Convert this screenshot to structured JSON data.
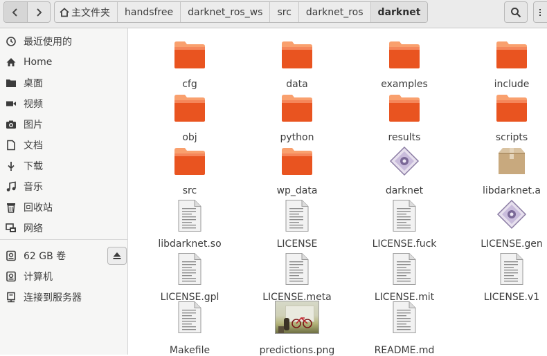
{
  "navigation": {
    "back_icon": "chevron-left-icon",
    "forward_icon": "chevron-right-icon"
  },
  "breadcrumbs": [
    {
      "label": "主文件夹",
      "icon": "home-icon"
    },
    {
      "label": "handsfree"
    },
    {
      "label": "darknet_ros_ws"
    },
    {
      "label": "src"
    },
    {
      "label": "darknet_ros"
    },
    {
      "label": "darknet"
    }
  ],
  "toolbar": {
    "search_icon": "search-icon",
    "menu_icon": "hamburger-menu-icon"
  },
  "sidebar": {
    "places": [
      {
        "label": "最近使用的",
        "icon": "recent-clock-icon"
      },
      {
        "label": "Home",
        "icon": "home-icon"
      },
      {
        "label": "桌面",
        "icon": "desktop-folder-icon"
      },
      {
        "label": "视频",
        "icon": "video-icon"
      },
      {
        "label": "图片",
        "icon": "camera-icon"
      },
      {
        "label": "文档",
        "icon": "document-icon"
      },
      {
        "label": "下载",
        "icon": "download-icon"
      },
      {
        "label": "音乐",
        "icon": "music-icon"
      },
      {
        "label": "回收站",
        "icon": "trash-icon"
      },
      {
        "label": "网络",
        "icon": "network-icon"
      }
    ],
    "devices": [
      {
        "label": "62 GB 卷",
        "icon": "drive-icon"
      },
      {
        "label": "计算机",
        "icon": "computer-drive-icon"
      },
      {
        "label": "连接到服务器",
        "icon": "server-icon"
      }
    ],
    "eject_icon": "eject-icon"
  },
  "files": [
    {
      "name": "cfg",
      "type": "folder"
    },
    {
      "name": "data",
      "type": "folder"
    },
    {
      "name": "examples",
      "type": "folder"
    },
    {
      "name": "include",
      "type": "folder"
    },
    {
      "name": "obj",
      "type": "folder"
    },
    {
      "name": "python",
      "type": "folder"
    },
    {
      "name": "results",
      "type": "folder"
    },
    {
      "name": "scripts",
      "type": "folder"
    },
    {
      "name": "src",
      "type": "folder"
    },
    {
      "name": "wp_data",
      "type": "folder"
    },
    {
      "name": "darknet",
      "type": "executable"
    },
    {
      "name": "libdarknet.a",
      "type": "archive"
    },
    {
      "name": "libdarknet.so",
      "type": "text"
    },
    {
      "name": "LICENSE",
      "type": "text"
    },
    {
      "name": "LICENSE.fuck",
      "type": "text"
    },
    {
      "name": "LICENSE.gen",
      "type": "executable"
    },
    {
      "name": "LICENSE.gpl",
      "type": "text"
    },
    {
      "name": "LICENSE.meta",
      "type": "text"
    },
    {
      "name": "LICENSE.mit",
      "type": "text"
    },
    {
      "name": "LICENSE.v1",
      "type": "text"
    },
    {
      "name": "Makefile",
      "type": "text"
    },
    {
      "name": "predictions.png",
      "type": "image"
    },
    {
      "name": "README.md",
      "type": "text"
    }
  ],
  "colors": {
    "folder_top": "#f9a06e",
    "folder_body": "#e95420",
    "header_bg": "#ebebeb",
    "sidebar_bg": "#f6f6f5"
  }
}
